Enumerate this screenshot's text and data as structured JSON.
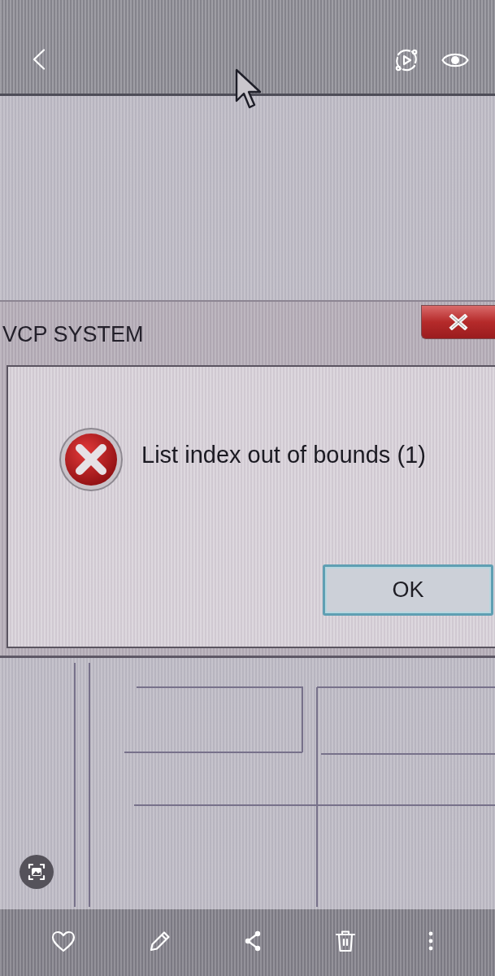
{
  "dialog": {
    "title": "VCP SYSTEM",
    "kind": "error",
    "message": "List index out of bounds (1)",
    "buttons": [
      {
        "label": "OK",
        "focused": true
      }
    ]
  }
}
